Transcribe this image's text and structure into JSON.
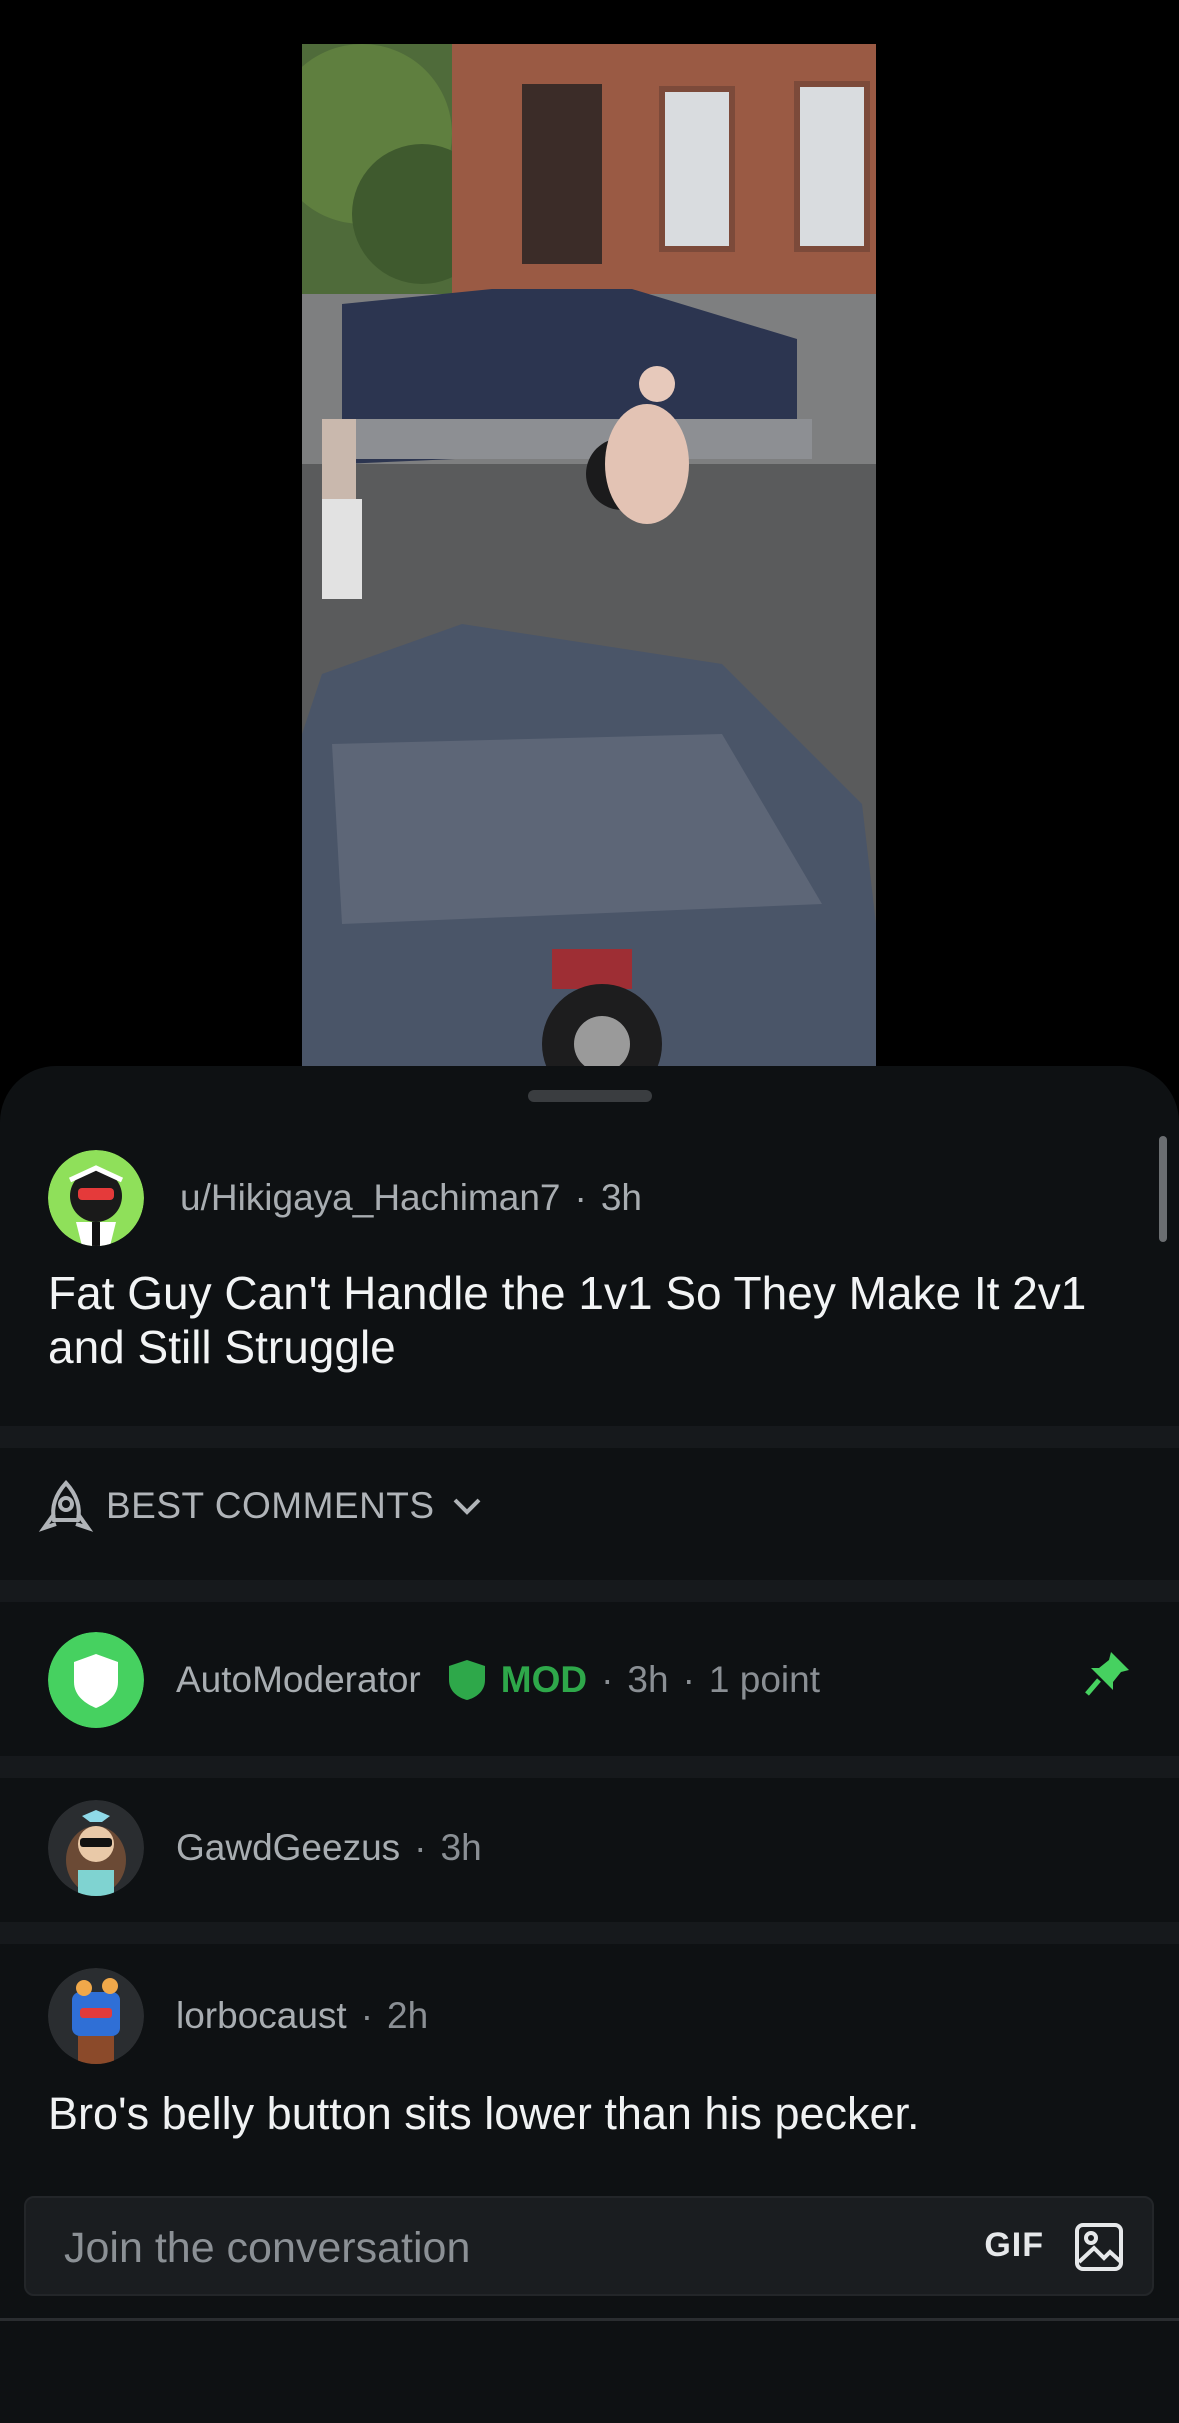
{
  "post": {
    "username": "u/Hikigaya_Hachiman7",
    "time": "3h",
    "title": "Fat Guy Can't Handle the 1v1 So They Make It 2v1 and Still Struggle"
  },
  "sort": {
    "label": "BEST COMMENTS"
  },
  "comments": [
    {
      "author": "AutoModerator",
      "badge": "MOD",
      "time": "3h",
      "points": "1 point",
      "pinned": true
    },
    {
      "author": "GawdGeezus",
      "time": "3h"
    },
    {
      "author": "lorbocaust",
      "time": "2h",
      "body": "Bro's belly button sits lower than his pecker."
    }
  ],
  "composer": {
    "placeholder": "Join the conversation",
    "gif_label": "GIF"
  },
  "colors": {
    "mod_green": "#2ea84a",
    "pin_green": "#46d160",
    "sheet_bg": "#0e1113"
  },
  "icons": [
    "shield-icon",
    "pin-icon",
    "image-icon",
    "chevron-down-icon",
    "rocket-icon"
  ]
}
